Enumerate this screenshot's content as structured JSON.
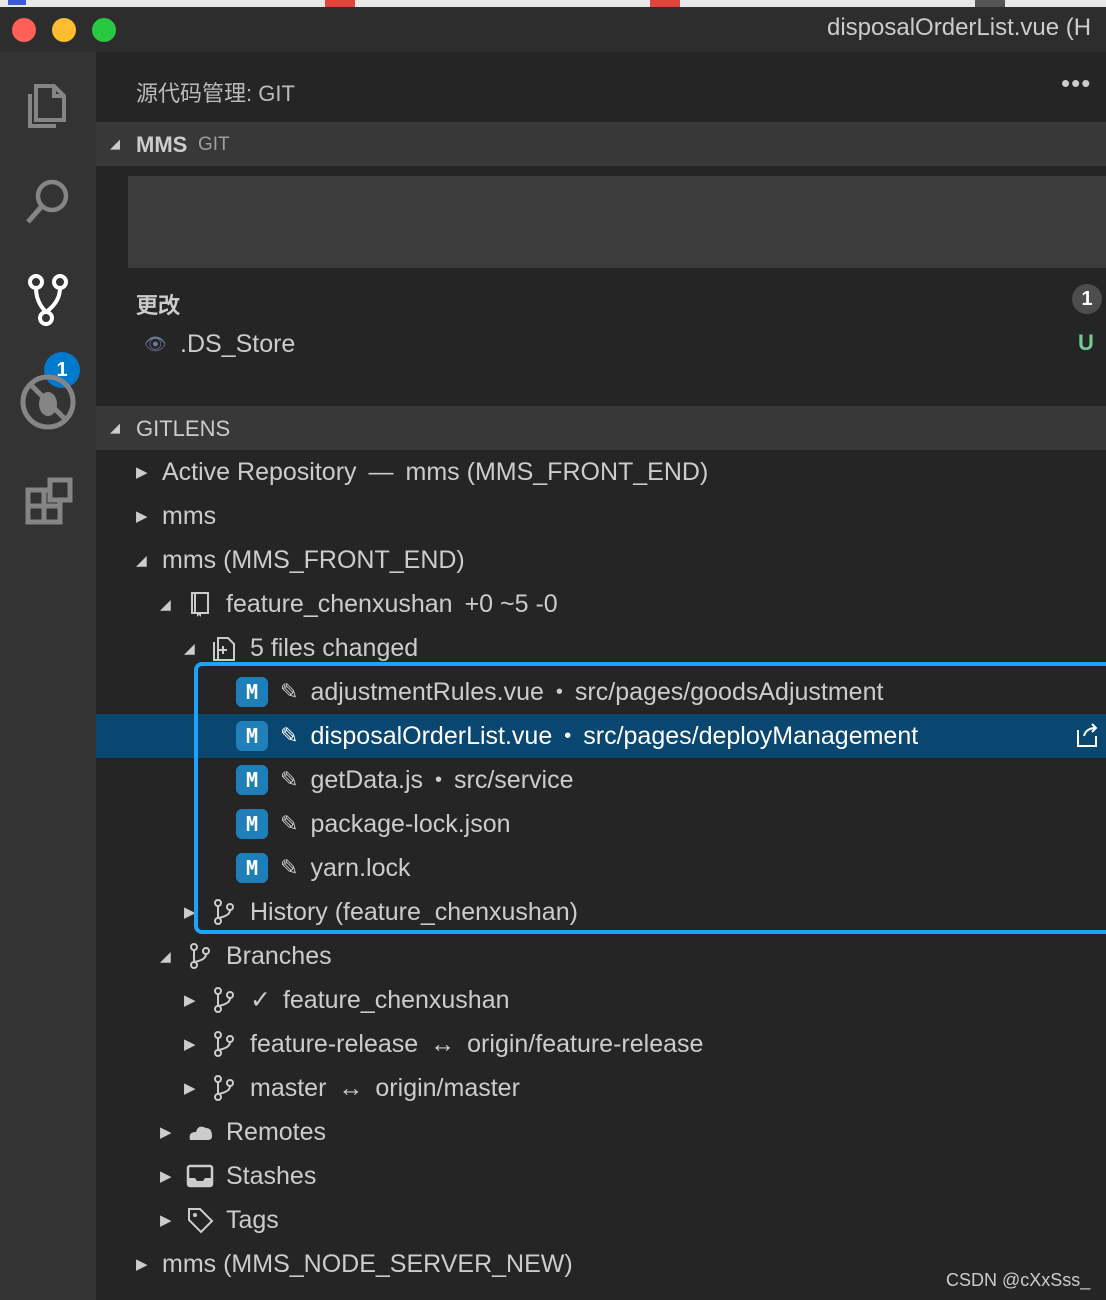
{
  "window": {
    "title": "disposalOrderList.vue (H",
    "colors": {
      "close": "#fe5f57",
      "minimize": "#febc2e",
      "zoom": "#28c840"
    }
  },
  "activity_bar": {
    "items": [
      {
        "icon": "files-icon"
      },
      {
        "icon": "search-icon"
      },
      {
        "icon": "source-control-icon",
        "badge": "1"
      },
      {
        "icon": "debug-icon"
      },
      {
        "icon": "extensions-icon"
      }
    ]
  },
  "scm": {
    "title": "源代码管理: GIT",
    "more": "•••",
    "repo_name": "MMS",
    "repo_provider": "GIT",
    "changes_label": "更改",
    "changes_count": "1",
    "changes": [
      {
        "file": ".DS_Store",
        "status": "U"
      }
    ]
  },
  "gitlens": {
    "header": "GITLENS",
    "active_repo_label": "Active Repository",
    "active_repo_sep": "—",
    "active_repo_value": "mms (MMS_FRONT_END)",
    "repo_mms": "mms",
    "repo_front_end": "mms (MMS_FRONT_END)",
    "current_branch": "feature_chenxushan",
    "current_branch_stats": "+0 ~5 -0",
    "files_changed_label": "5 files changed",
    "files": [
      {
        "status": "M",
        "name": "adjustmentRules.vue",
        "dot": "•",
        "path": "src/pages/goodsAdjustment"
      },
      {
        "status": "M",
        "name": "disposalOrderList.vue",
        "dot": "•",
        "path": "src/pages/deployManagement"
      },
      {
        "status": "M",
        "name": "getData.js",
        "dot": "•",
        "path": "src/service"
      },
      {
        "status": "M",
        "name": "package-lock.json"
      },
      {
        "status": "M",
        "name": "yarn.lock"
      }
    ],
    "history_label": "History (feature_chenxushan)",
    "branches_label": "Branches",
    "branches": [
      {
        "check": "✓",
        "name": "feature_chenxushan"
      },
      {
        "name": "feature-release",
        "arrow": "↔",
        "upstream": "origin/feature-release"
      },
      {
        "name": "master",
        "arrow": "↔",
        "upstream": "origin/master"
      }
    ],
    "remotes_label": "Remotes",
    "stashes_label": "Stashes",
    "tags_label": "Tags",
    "repo_node_server": "mms (MMS_NODE_SERVER_NEW)",
    "accent_color": "#1aa3ff",
    "selection_color": "#094771"
  },
  "watermark": "CSDN @cXxSss_"
}
